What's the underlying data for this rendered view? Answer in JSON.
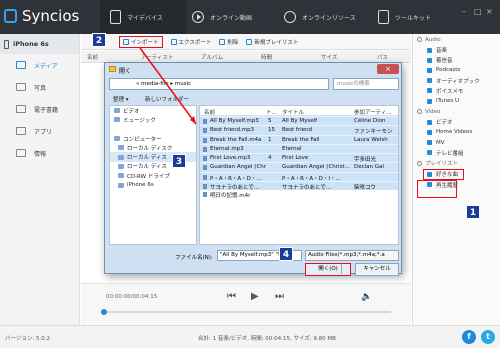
{
  "app": {
    "name": "Syncios"
  },
  "nav": [
    {
      "label": "マイデバイス",
      "icon": "phone-icon"
    },
    {
      "label": "オンライン動画",
      "icon": "play-icon"
    },
    {
      "label": "オンラインリソース",
      "icon": "globe-icon"
    },
    {
      "label": "ツールキット",
      "icon": "toolkit-icon"
    }
  ],
  "device": {
    "name": "iPhone 6s"
  },
  "left_menu": [
    {
      "label": "メディア",
      "icon": "media-icon"
    },
    {
      "label": "写真",
      "icon": "photo-icon"
    },
    {
      "label": "電子書籍",
      "icon": "book-icon"
    },
    {
      "label": "アプリ",
      "icon": "apps-icon"
    },
    {
      "label": "情報",
      "icon": "info-icon"
    }
  ],
  "toolbar": {
    "import": "インポート",
    "export": "エクスポート",
    "delete": "削除",
    "new_playlist": "新規プレイリスト"
  },
  "table_headers": [
    "名前",
    "アーティスト",
    "アルバム",
    "時間",
    "サイズ",
    "パス"
  ],
  "player": {
    "time": "00:00:00/00:04:15"
  },
  "right_pane": {
    "audio_section": "Audio",
    "audio_items": [
      "音楽",
      "着信音",
      "Podcasts",
      "オーディオブック",
      "ボイスメモ",
      "iTunes U"
    ],
    "video_section": "Video",
    "video_items": [
      "ビデオ",
      "Home Videos",
      "MV",
      "テレビ番組"
    ],
    "playlist_section": "プレイリスト",
    "playlist_items": [
      "好きな曲",
      "再生履歴"
    ]
  },
  "status": {
    "version": "バージョン: 5.0.2",
    "summary": "合計: 1 音楽/ビデオ, 時間: 00:04:15, サイズ: 9.80 MB"
  },
  "dialog": {
    "title": "開く",
    "address": "« media-file ▸ music",
    "search_placeholder": "musicの検索",
    "organize": "整理 ▾",
    "new_folder": "新しいフォルダー",
    "nav_tree": [
      {
        "label": "ビデオ",
        "sub": false
      },
      {
        "label": "ミュージック",
        "sub": false
      },
      {
        "label": "",
        "sub": false
      },
      {
        "label": "コンピューター",
        "sub": false
      },
      {
        "label": "ローカル ディスク",
        "sub": true
      },
      {
        "label": "ローカル ディス",
        "sub": true
      },
      {
        "label": "ローカル ディス",
        "sub": true
      },
      {
        "label": "CD-RW ドライブ",
        "sub": true
      },
      {
        "label": "iPhone 6s",
        "sub": true
      }
    ],
    "file_headers": [
      "名前",
      "ト...",
      "タイトル",
      "参加アーティ..."
    ],
    "files": [
      {
        "name": "All By Myself.mp3",
        "track": "5",
        "title": "All By Myself",
        "artist": "Céline Dion",
        "sel": true
      },
      {
        "name": "Best friend.mp3",
        "track": "15",
        "title": "Best friend",
        "artist": "ファンキーモン",
        "sel": true
      },
      {
        "name": "Break the Fall.m4a",
        "track": "1",
        "title": "Break the Fall",
        "artist": "Laura Welsh",
        "sel": true
      },
      {
        "name": "Eternal.mp3",
        "track": "",
        "title": "Eternal",
        "artist": "",
        "sel": true
      },
      {
        "name": "First Love.mp3",
        "track": "4",
        "title": "First Love",
        "artist": "宇多田光",
        "sel": true
      },
      {
        "name": "Guardian Angel (Chr...",
        "track": "",
        "title": "Guardian Angel (Christ...",
        "artist": "Declan Gal",
        "sel": true
      },
      {
        "name": "P・A・R・A・D・...",
        "track": "",
        "title": "P・A・R・A・D・I・...",
        "artist": "",
        "sel": true
      },
      {
        "name": "サヨナラのあとで...",
        "track": "",
        "title": "サヨナラのあとで...",
        "artist": "柴咲コウ",
        "sel": true
      },
      {
        "name": "明日の記憶.m4r",
        "track": "",
        "title": "",
        "artist": "",
        "sel": false
      }
    ],
    "filename_label": "ファイル名(N):",
    "filename_value": "\"All By Myself.mp3\" \"Best",
    "filetype_value": "Audio Files(*.mp3;*.m4a;*.a",
    "open": "開く(O)",
    "cancel": "キャンセル"
  },
  "badges": [
    "1",
    "2",
    "3",
    "4"
  ],
  "colors": {
    "accent": "#1f8ad8",
    "highlight_red": "#e8101b",
    "badge_blue": "#1b3c9b",
    "topbar": "#2f3238"
  }
}
